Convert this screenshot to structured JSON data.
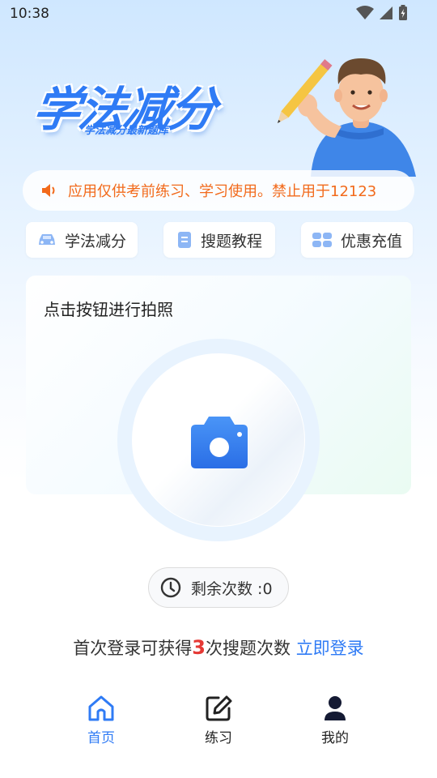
{
  "status_bar": {
    "time": "10:38"
  },
  "banner": {
    "title": "学法减分",
    "subtitle": "学法减分最新题库"
  },
  "notice": {
    "icon": "speaker-icon",
    "text": "应用仅供考前练习、学习使用。禁止用于12123"
  },
  "quick_actions": [
    {
      "label": "学法减分",
      "icon": "car-icon"
    },
    {
      "label": "搜题教程",
      "icon": "document-icon"
    },
    {
      "label": "优惠充值",
      "icon": "coupon-icon"
    }
  ],
  "photo_card": {
    "title": "点击按钮进行拍照",
    "icon": "camera-icon"
  },
  "remaining": {
    "label": "剩余次数 :0",
    "icon": "clock-icon"
  },
  "login_prompt": {
    "prefix": "首次登录可获得",
    "count": "3",
    "suffix": "次搜题次数",
    "link": "立即登录"
  },
  "tabs": [
    {
      "label": "首页",
      "icon": "home-icon",
      "active": true
    },
    {
      "label": "练习",
      "icon": "edit-icon",
      "active": false
    },
    {
      "label": "我的",
      "icon": "user-icon",
      "active": false
    }
  ],
  "colors": {
    "accent": "#2f7bf5",
    "notice": "#f26a1b",
    "highlight": "#e53935"
  }
}
